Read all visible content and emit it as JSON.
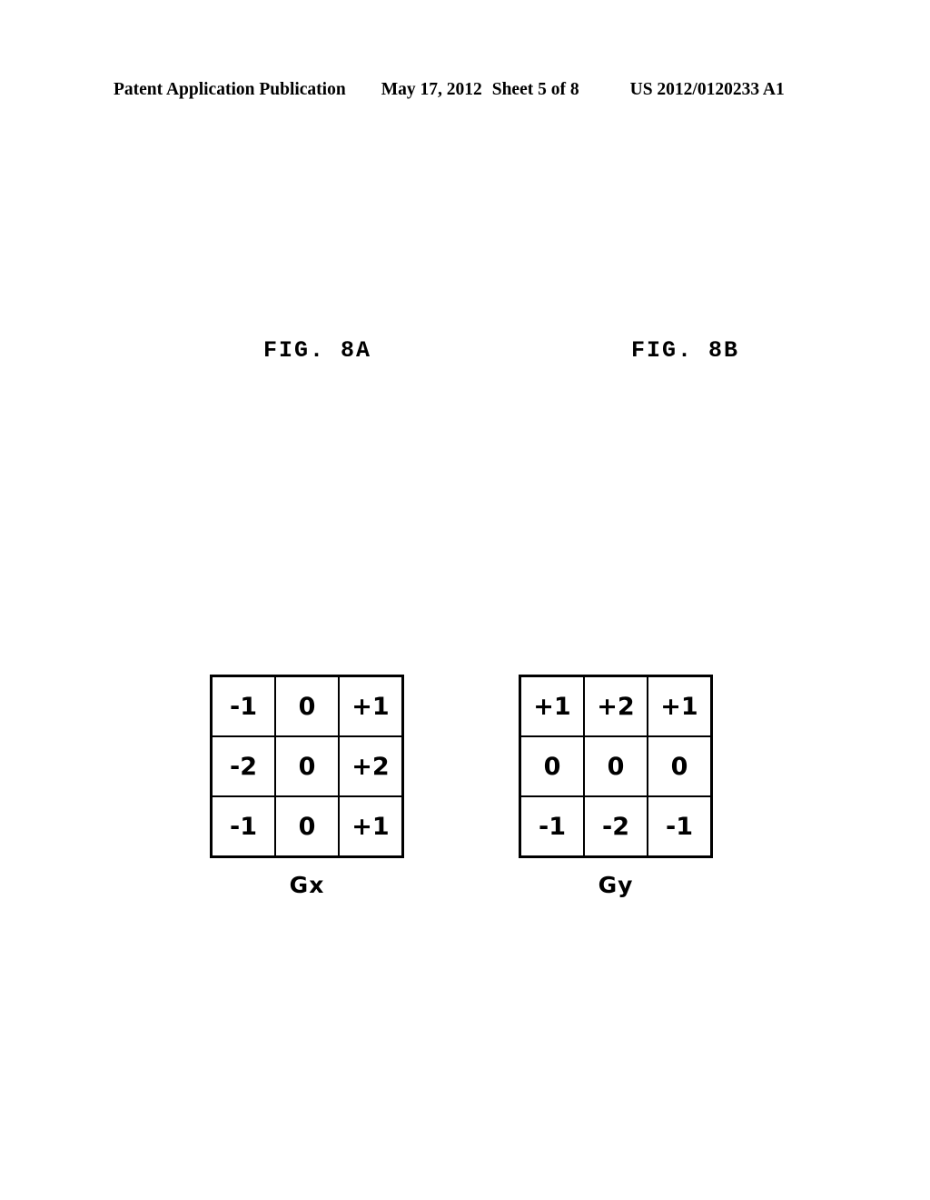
{
  "header": {
    "publication": "Patent Application Publication",
    "date": "May 17, 2012",
    "sheet": "Sheet 5 of 8",
    "document_number": "US 2012/0120233 A1"
  },
  "figures": [
    {
      "title": "FIG. 8A",
      "caption": "Gx",
      "matrix": [
        [
          "-1",
          "0",
          "+1"
        ],
        [
          "-2",
          "0",
          "+2"
        ],
        [
          "-1",
          "0",
          "+1"
        ]
      ]
    },
    {
      "title": "FIG. 8B",
      "caption": "Gy",
      "matrix": [
        [
          "+1",
          "+2",
          "+1"
        ],
        [
          "0",
          "0",
          "0"
        ],
        [
          "-1",
          "-2",
          "-1"
        ]
      ]
    }
  ],
  "colors": {
    "ink": "#000000",
    "paper": "#ffffff"
  }
}
